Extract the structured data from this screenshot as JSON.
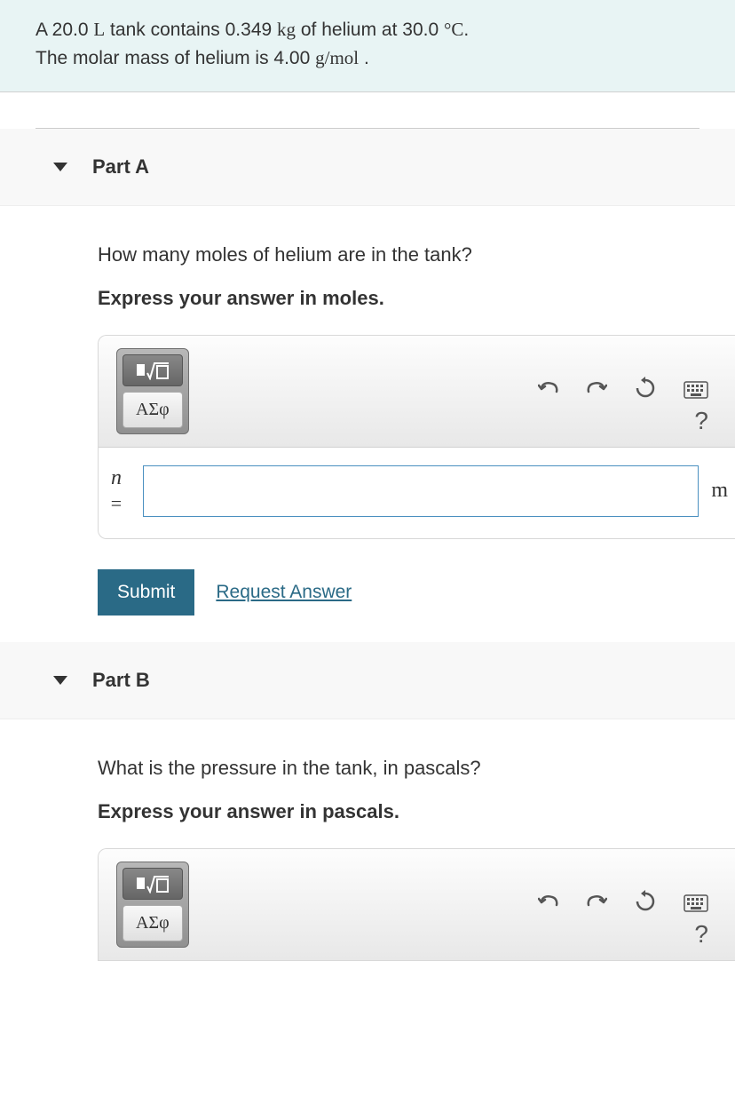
{
  "problem": {
    "line1_pre": "A 20.0 ",
    "line1_unit1": "L",
    "line1_mid1": " tank contains 0.349 ",
    "line1_unit2": "kg",
    "line1_mid2": " of helium at 30.0 ",
    "line1_unit3": "°C",
    "line1_post": ".",
    "line2_pre": "The molar mass of helium is 4.00 ",
    "line2_unit": "g/mol",
    "line2_post": " ."
  },
  "partA": {
    "title": "Part A",
    "question": "How many moles of helium are in the tank?",
    "instruction": "Express your answer in moles.",
    "greek_btn": "ΑΣφ",
    "help": "?",
    "var": "n",
    "eq": "=",
    "unit": "m",
    "submit": "Submit",
    "request": "Request Answer"
  },
  "partB": {
    "title": "Part B",
    "question": "What is the pressure in the tank, in pascals?",
    "instruction": "Express your answer in pascals.",
    "greek_btn": "ΑΣφ",
    "help": "?"
  }
}
